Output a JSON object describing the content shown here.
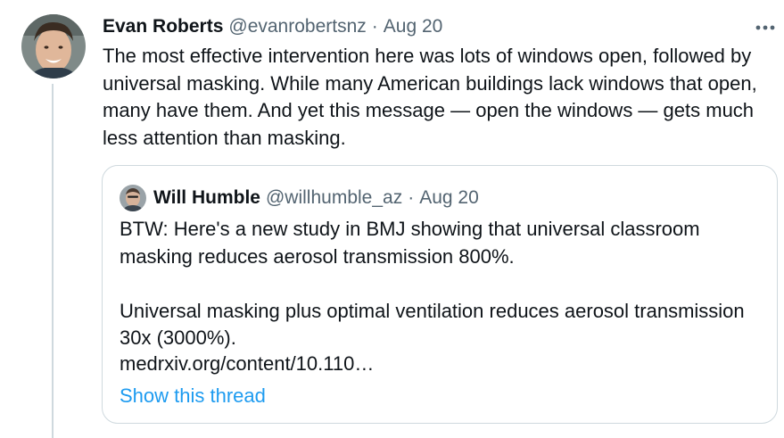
{
  "tweet": {
    "author": {
      "name": "Evan Roberts",
      "handle": "@evanrobertsnz"
    },
    "separator": "·",
    "date": "Aug 20",
    "more_icon": "more-horizontal-icon",
    "text": "The most effective intervention here was lots of windows open, followed by universal masking. While many American buildings lack windows that open, many have them. And yet this message — open the windows — gets much less attention than masking."
  },
  "quoted_tweet": {
    "author": {
      "name": "Will Humble",
      "handle": "@willhumble_az"
    },
    "separator": "·",
    "date": "Aug 20",
    "paragraph_1": "BTW: Here's a new study in BMJ showing that universal classroom masking reduces aerosol transmission 800%.",
    "paragraph_2": "Universal masking plus optimal ventilation reduces aerosol transmission 30x (3000%).",
    "link": "medrxiv.org/content/10.110…",
    "show_thread": "Show this thread"
  },
  "colors": {
    "text_primary": "#0f1419",
    "text_secondary": "#536471",
    "link_blue": "#1d9bf0",
    "border": "#cfd9de"
  }
}
